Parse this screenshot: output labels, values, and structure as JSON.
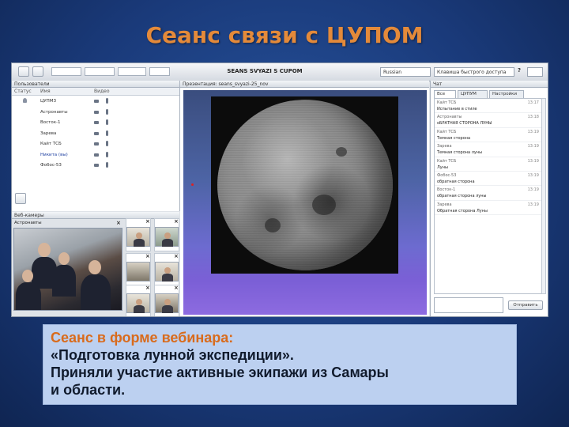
{
  "slide": {
    "title": "Сеанс связи с ЦУПОМ"
  },
  "app": {
    "title": "SEANS SVYAZI S CUPOM",
    "language": "Russian",
    "hotkey_placeholder": "Клавиша быстрого доступа",
    "help": "?"
  },
  "users": {
    "header": "Пользователи",
    "columns": [
      "Статус",
      "Имя",
      "Видео"
    ],
    "rows": [
      {
        "name": "ЦУПМЗ"
      },
      {
        "name": "Астронавты"
      },
      {
        "name": "Восток-1"
      },
      {
        "name": "Зарева"
      },
      {
        "name": "Кайт ТСБ"
      },
      {
        "name": "Никита (вы)",
        "current": true
      },
      {
        "name": "Фобос-53"
      }
    ]
  },
  "webinar": {
    "header": "Веб-камеры",
    "main_label": "Астронавты"
  },
  "presentation": {
    "header": "Презентация: seans_svyazi-25_nov"
  },
  "chat": {
    "header": "Чат",
    "tabs": [
      "Все",
      "ЦУПУМ",
      "Настройки"
    ],
    "messages": [
      {
        "who": "Кайт ТСБ",
        "time": "13:17",
        "text": "Испытание в стиле"
      },
      {
        "who": "Астронавты",
        "time": "13:18",
        "text": "оБРАТНАЯ СТОРОНА ЛУНЫ"
      },
      {
        "who": "Кайт ТСБ",
        "time": "13:19",
        "text": "Темная сторона"
      },
      {
        "who": "Зарева",
        "time": "13:19",
        "text": "Темная сторона луны"
      },
      {
        "who": "Кайт ТСБ",
        "time": "13:19",
        "text": "Луны"
      },
      {
        "who": "Фобос-53",
        "time": "13:19",
        "text": "обратная сторона"
      },
      {
        "who": "Восток-1",
        "time": "13:19",
        "text": "обратная сторона луны"
      },
      {
        "who": "Зарева",
        "time": "13:19",
        "text": "Обратная сторона Луны"
      }
    ],
    "send_label": "Отправить"
  },
  "caption": {
    "heading": "Сеанс в форме вебинара:",
    "line1": "«Подготовка лунной экспедиции».",
    "line2": "Приняли участие активные экипажи из Самары",
    "line3": "и области."
  }
}
